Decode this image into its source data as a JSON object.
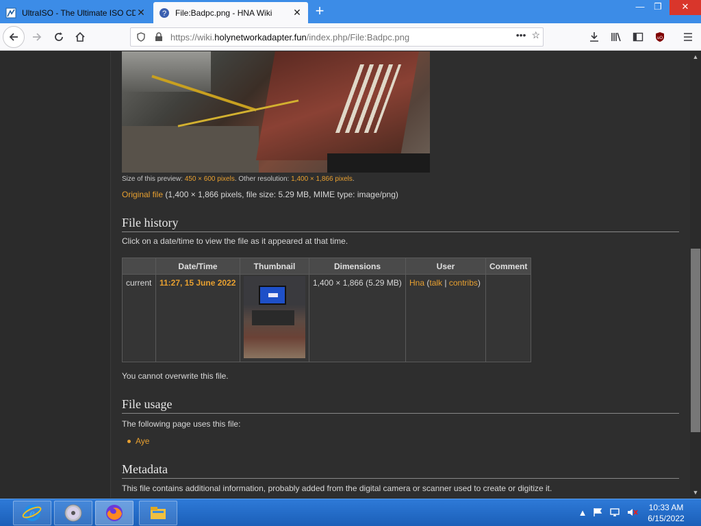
{
  "browser": {
    "tabs": [
      {
        "title": "UltraISO - The Ultimate ISO CD",
        "active": false,
        "favicon": "ultraiso-icon"
      },
      {
        "title": "File:Badpc.png - HNA Wiki",
        "active": true,
        "favicon": "wiki-question-icon"
      }
    ],
    "url_prefix": "https://wiki.",
    "url_domain": "holynetworkadapter.fun",
    "url_path": "/index.php/File:Badpc.png",
    "accent": "#3c8ce7"
  },
  "page": {
    "size_preview_label": "Size of this preview: ",
    "size_preview_link": "450 × 600 pixels",
    "other_res_label": ". Other resolution: ",
    "other_res_link": "1,400 × 1,866 pixels",
    "other_res_end": ".",
    "original_link": "Original file",
    "original_info": " (1,400 × 1,866 pixels, file size: 5.29 MB, MIME type: image/png)",
    "file_history_title": "File history",
    "file_history_desc": "Click on a date/time to view the file as it appeared at that time.",
    "history_table": {
      "headers": [
        "",
        "Date/Time",
        "Thumbnail",
        "Dimensions",
        "User",
        "Comment"
      ],
      "row": {
        "status": "current",
        "datetime": "11:27, 15 June 2022",
        "dimensions": "1,400 × 1,866 (5.29 MB)",
        "user": "Hna",
        "user_talk": "talk",
        "user_contribs": "contribs",
        "comment": ""
      }
    },
    "overwrite_note": "You cannot overwrite this file.",
    "file_usage_title": "File usage",
    "file_usage_desc": "The following page uses this file:",
    "usage_pages": [
      "Aye"
    ],
    "metadata_title": "Metadata",
    "metadata_desc": "This file contains additional information, probably added from the digital camera or scanner used to create or digitize it.",
    "link_color": "#e8a030"
  },
  "taskbar": {
    "apps": [
      "internet-explorer-icon",
      "disc-icon",
      "firefox-icon",
      "file-explorer-icon"
    ],
    "time": "10:33 AM",
    "date": "6/15/2022"
  }
}
